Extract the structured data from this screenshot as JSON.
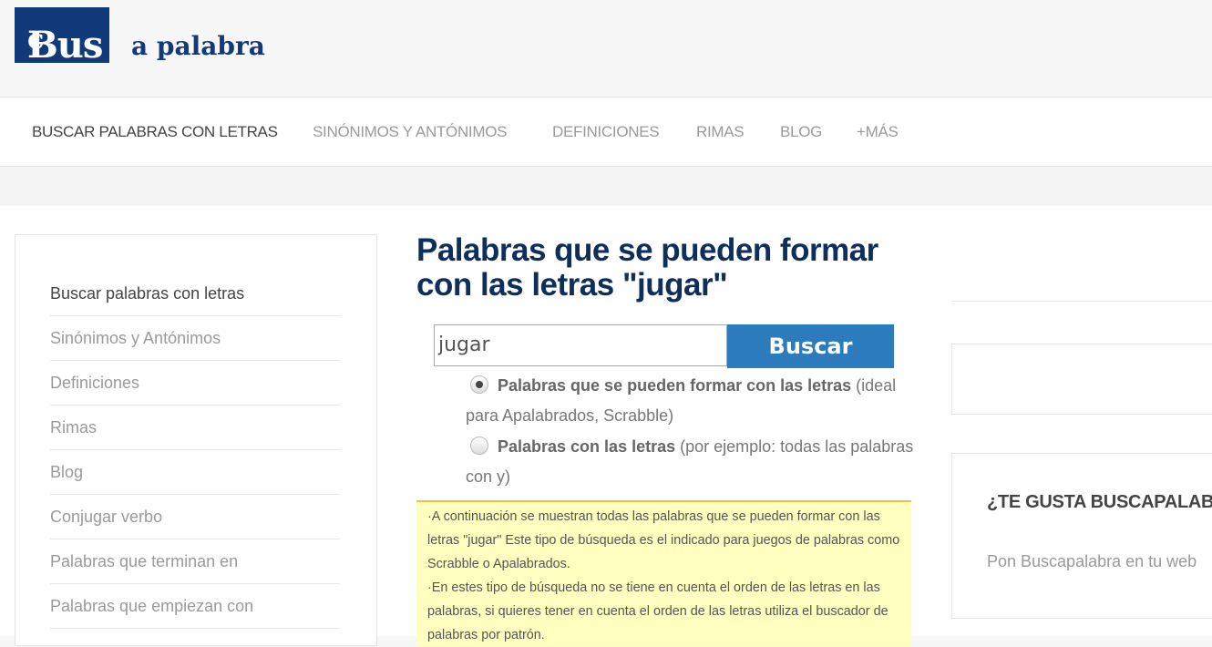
{
  "logo": {
    "part1": "Bus",
    "part2": "c",
    "part3": "a palabra"
  },
  "nav": [
    {
      "label": "BUSCAR PALABRAS CON LETRAS"
    },
    {
      "label": "SINÓNIMOS Y ANTÓNIMOS"
    },
    {
      "label": "DEFINICIONES"
    },
    {
      "label": "RIMAS"
    },
    {
      "label": "BLOG"
    },
    {
      "label": "+MÁS"
    }
  ],
  "sidebar": {
    "items": [
      {
        "label": "Buscar palabras con letras"
      },
      {
        "label": "Sinónimos y Antónimos"
      },
      {
        "label": "Definiciones"
      },
      {
        "label": "Rimas"
      },
      {
        "label": "Blog"
      },
      {
        "label": "Conjugar verbo"
      },
      {
        "label": "Palabras que terminan en"
      },
      {
        "label": "Palabras que empiezan con"
      }
    ]
  },
  "main": {
    "title_line1": "Palabras que se pueden formar",
    "title_line2": "con las letras \"jugar\"",
    "search_value": "jugar",
    "search_button": "Buscar",
    "option1_bold": "Palabras que se pueden formar con las letras",
    "option1_rest": " (ideal para Apalabrados, Scrabble)",
    "option2_bold": "Palabras con las letras",
    "option2_rest": " (por ejemplo: todas las palabras con y)",
    "notice_p1": "·A continuación se muestran todas las palabras que se pueden formar con las letras \"jugar\" Este tipo de búsqueda es el indicado para juegos de palabras como Scrabble o Apalabrados.",
    "notice_p2": "·En estes tipo de búsqueda no se tiene en cuenta el orden de las letras en las palabras, si quieres tener en cuenta el orden de las letras utiliza el buscador de palabras por patrón."
  },
  "right": {
    "title": "¿TE GUSTA BUSCAPALABRA?",
    "text": "Pon Buscapalabra en tu web"
  }
}
